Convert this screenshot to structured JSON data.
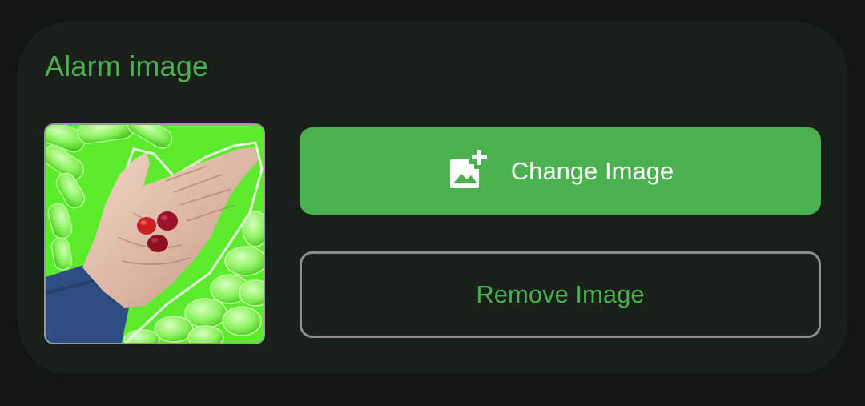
{
  "section": {
    "title": "Alarm image"
  },
  "image": {
    "description": "hand holding red gummies over green background",
    "accent": "#5bea2c"
  },
  "actions": {
    "change_label": "Change Image",
    "change_icon": "add-photo-icon",
    "remove_label": "Remove Image"
  },
  "colors": {
    "background": "#111611",
    "card": "#182019",
    "accent": "#4caf50",
    "outline": "#8e8e8e",
    "on_accent": "#ffffff"
  }
}
